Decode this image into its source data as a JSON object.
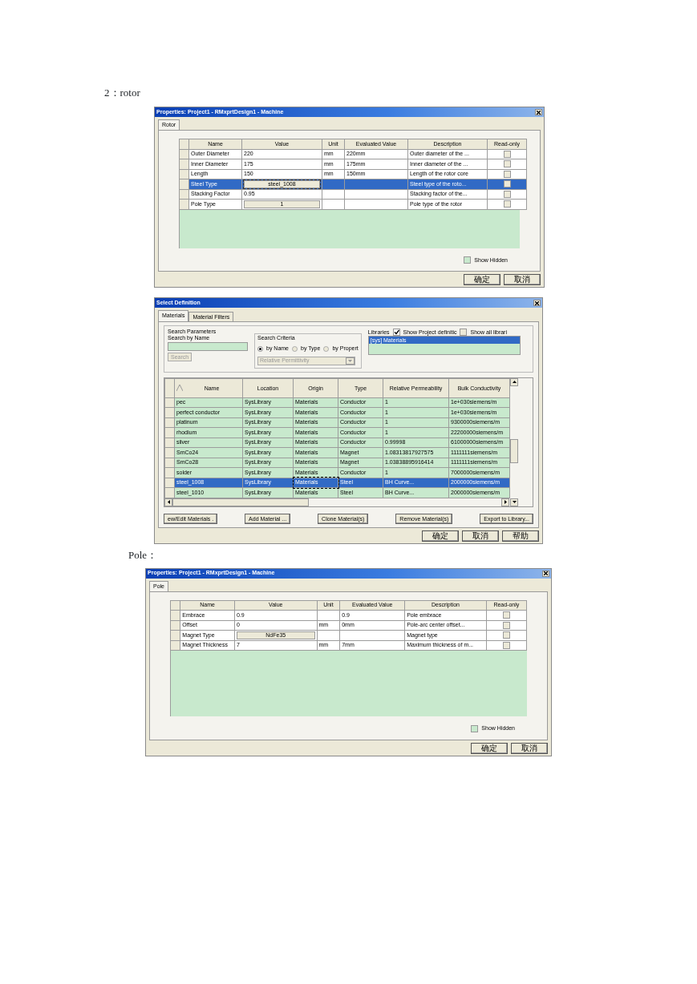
{
  "caption_rotor": "2：rotor",
  "rotor_dialog": {
    "title": "Properties: Project1 - RMxprtDesign1 - Machine",
    "tabs": [
      {
        "label": "Rotor",
        "selected": true
      }
    ],
    "table": {
      "columns": [
        "Name",
        "Value",
        "Unit",
        "Evaluated Value",
        "Description",
        "Read-only"
      ],
      "rows": [
        {
          "name": "Outer Diameter",
          "value": "220",
          "kind": "text",
          "unit": "mm",
          "evaluated": "220mm",
          "description": "Outer diameter of the ...",
          "read_only": false,
          "selected": false
        },
        {
          "name": "Inner Diameter",
          "value": "175",
          "kind": "text",
          "unit": "mm",
          "evaluated": "175mm",
          "description": "Inner diameter of the ...",
          "read_only": false,
          "selected": false
        },
        {
          "name": "Length",
          "value": "150",
          "kind": "text",
          "unit": "mm",
          "evaluated": "150mm",
          "description": "Length of the rotor core",
          "read_only": false,
          "selected": false
        },
        {
          "name": "Steel Type",
          "value": "steel_1008",
          "kind": "button",
          "description": "Steel type of the roto...",
          "read_only": false,
          "selected": true
        },
        {
          "name": "Stacking Factor",
          "value": "0.95",
          "kind": "text",
          "description": "Stacking factor of the...",
          "read_only": false,
          "selected": false
        },
        {
          "name": "Pole Type",
          "value": "1",
          "kind": "button",
          "description": "Pole type of the rotor",
          "read_only": false,
          "selected": false
        }
      ]
    },
    "show_hidden": {
      "label": "Show Hidden",
      "checked": false
    },
    "buttons": [
      "确定",
      "取消"
    ]
  },
  "select_dialog": {
    "title": "Select Definition",
    "tabs": [
      {
        "label": "Materials",
        "selected": true
      },
      {
        "label": "Material Filters",
        "selected": false
      }
    ],
    "search_parameters": {
      "legend": "Search Parameters",
      "label": "Search by Name",
      "button": {
        "label": "Search",
        "disabled": true
      }
    },
    "search_criteria": {
      "legend": "Search Criteria",
      "options": [
        {
          "label": "by Name",
          "selected": true
        },
        {
          "label": "by Type",
          "selected": false
        },
        {
          "label": "by Propert",
          "selected": false
        }
      ],
      "dropdown": {
        "value": "Relative Permittivity",
        "disabled": true
      }
    },
    "libraries": {
      "label": "Libraries",
      "show_project": {
        "label": "Show Project definitic",
        "checked": true
      },
      "show_all": {
        "label": "Show all librari",
        "checked": false
      },
      "items": [
        {
          "label": "[sys] Materials",
          "selected": true
        }
      ]
    },
    "table": {
      "columns": [
        "Name",
        "Location",
        "Origin",
        "Type",
        "Relative Permeability",
        "Bulk Conductivity"
      ],
      "rows": [
        {
          "cells": [
            "pec",
            "SysLibrary",
            "Materials",
            "Conductor",
            "1",
            "1e+030siemens/m"
          ],
          "selected": false
        },
        {
          "cells": [
            "perfect conductor",
            "SysLibrary",
            "Materials",
            "Conductor",
            "1",
            "1e+030siemens/m"
          ],
          "selected": false
        },
        {
          "cells": [
            "platinum",
            "SysLibrary",
            "Materials",
            "Conductor",
            "1",
            "9300000siemens/m"
          ],
          "selected": false
        },
        {
          "cells": [
            "rhodium",
            "SysLibrary",
            "Materials",
            "Conductor",
            "1",
            "22200000siemens/m"
          ],
          "selected": false
        },
        {
          "cells": [
            "silver",
            "SysLibrary",
            "Materials",
            "Conductor",
            "0.99998",
            "61000000siemens/m"
          ],
          "selected": false
        },
        {
          "cells": [
            "SmCo24",
            "SysLibrary",
            "Materials",
            "Magnet",
            "1.08313817927575",
            "1111111siemens/m"
          ],
          "selected": false
        },
        {
          "cells": [
            "SmCo28",
            "SysLibrary",
            "Materials",
            "Magnet",
            "1.03838895916414",
            "1111111siemens/m"
          ],
          "selected": false
        },
        {
          "cells": [
            "solder",
            "SysLibrary",
            "Materials",
            "Conductor",
            "1",
            "7000000siemens/m"
          ],
          "selected": false
        },
        {
          "cells": [
            "steel_1008",
            "SysLibrary",
            "Materials",
            "Steel",
            "BH Curve...",
            "2000000siemens/m"
          ],
          "selected": true
        },
        {
          "cells": [
            "steel_1010",
            "SysLibrary",
            "Materials",
            "Steel",
            "BH Curve...",
            "2000000siemens/m"
          ],
          "selected": false
        }
      ]
    },
    "actions": [
      "ew/Edit Materials .",
      "Add Material ...",
      "Clone Material(s)",
      "Remove Material(s)",
      "Export to Library..."
    ],
    "buttons": [
      "确定",
      "取消",
      "帮助"
    ]
  },
  "caption_pole": "Pole：",
  "pole_dialog": {
    "title": "Properties: Project1 - RMxprtDesign1 - Machine",
    "tabs": [
      {
        "label": "Pole",
        "selected": true
      }
    ],
    "table": {
      "columns": [
        "Name",
        "Value",
        "Unit",
        "Evaluated Value",
        "Description",
        "Read-only"
      ],
      "rows": [
        {
          "name": "Embrace",
          "value": "0.9",
          "kind": "text",
          "evaluated": "0.9",
          "description": "Pole embrace",
          "read_only": false,
          "selected": false
        },
        {
          "name": "Offset",
          "value": "0",
          "kind": "text",
          "unit": "mm",
          "evaluated": "0mm",
          "description": "Pole-arc center offset...",
          "read_only": false,
          "selected": false
        },
        {
          "name": "Magnet Type",
          "value": "NdFe35",
          "kind": "button",
          "description": "Magnet type",
          "read_only": false,
          "selected": false
        },
        {
          "name": "Magnet Thickness",
          "value": "7",
          "kind": "text",
          "unit": "mm",
          "evaluated": "7mm",
          "description": "Maximum thickness of m...",
          "read_only": false,
          "selected": false
        }
      ]
    },
    "show_hidden": {
      "label": "Show Hidden",
      "checked": false
    },
    "buttons": [
      "确定",
      "取消"
    ]
  }
}
